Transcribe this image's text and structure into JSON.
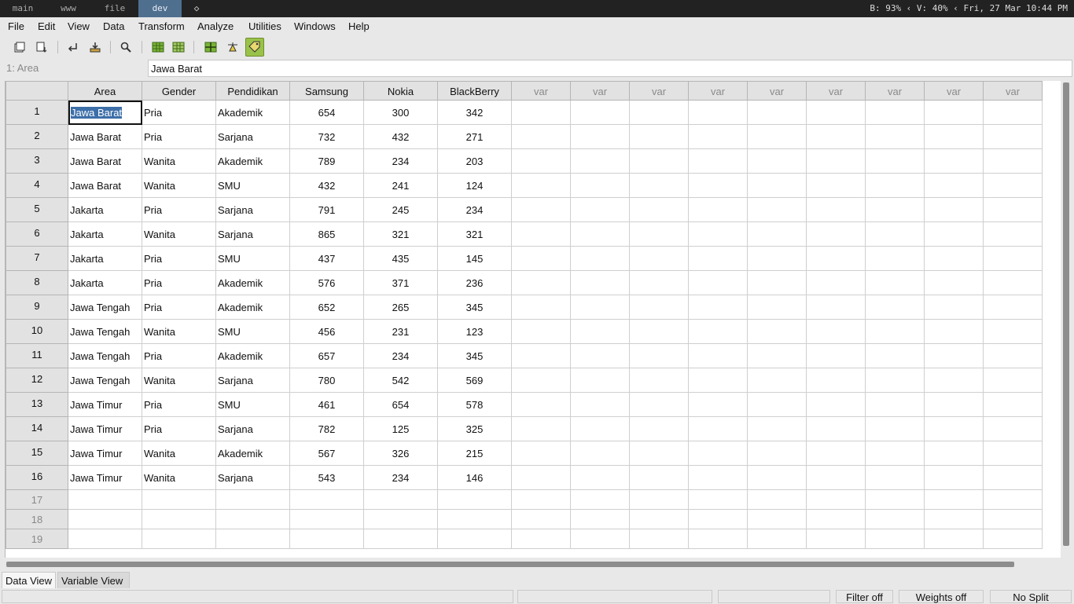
{
  "topbar": {
    "workspaces": [
      {
        "label": "main",
        "active": false
      },
      {
        "label": "www",
        "active": false
      },
      {
        "label": "file",
        "active": false
      },
      {
        "label": "dev",
        "active": true
      }
    ],
    "layout_symbol": "◇",
    "status": "B: 93% ‹ V: 40% ‹ Fri, 27 Mar 10:44 PM"
  },
  "menu": [
    "File",
    "Edit",
    "View",
    "Data",
    "Transform",
    "Analyze",
    "Utilities",
    "Windows",
    "Help"
  ],
  "toolbar": {
    "icons": [
      "open-file-icon",
      "save-file-icon",
      "goto-case-icon",
      "import-icon",
      "find-icon",
      "insert-cases-icon",
      "insert-variable-icon",
      "split-file-icon",
      "weight-cases-icon",
      "value-labels-icon"
    ]
  },
  "cellref": {
    "name": "1: Area",
    "value": "Jawa Barat"
  },
  "columns": [
    "Area",
    "Gender",
    "Pendidikan",
    "Samsung",
    "Nokia",
    "BlackBerry",
    "var",
    "var",
    "var",
    "var",
    "var",
    "var",
    "var",
    "var",
    "var"
  ],
  "rows": [
    {
      "n": "1",
      "cells": [
        "Jawa Barat",
        "Pria",
        "Akademik",
        "654",
        "300",
        "342"
      ]
    },
    {
      "n": "2",
      "cells": [
        "Jawa Barat",
        "Pria",
        "Sarjana",
        "732",
        "432",
        "271"
      ]
    },
    {
      "n": "3",
      "cells": [
        "Jawa Barat",
        "Wanita",
        "Akademik",
        "789",
        "234",
        "203"
      ]
    },
    {
      "n": "4",
      "cells": [
        "Jawa Barat",
        "Wanita",
        "SMU",
        "432",
        "241",
        "124"
      ]
    },
    {
      "n": "5",
      "cells": [
        "Jakarta",
        "Pria",
        "Sarjana",
        "791",
        "245",
        "234"
      ]
    },
    {
      "n": "6",
      "cells": [
        "Jakarta",
        "Wanita",
        "Sarjana",
        "865",
        "321",
        "321"
      ]
    },
    {
      "n": "7",
      "cells": [
        "Jakarta",
        "Pria",
        "SMU",
        "437",
        "435",
        "145"
      ]
    },
    {
      "n": "8",
      "cells": [
        "Jakarta",
        "Pria",
        "Akademik",
        "576",
        "371",
        "236"
      ]
    },
    {
      "n": "9",
      "cells": [
        "Jawa Tengah",
        "Pria",
        "Akademik",
        "652",
        "265",
        "345"
      ]
    },
    {
      "n": "10",
      "cells": [
        "Jawa Tengah",
        "Wanita",
        "SMU",
        "456",
        "231",
        "123"
      ]
    },
    {
      "n": "11",
      "cells": [
        "Jawa Tengah",
        "Pria",
        "Akademik",
        "657",
        "234",
        "345"
      ]
    },
    {
      "n": "12",
      "cells": [
        "Jawa Tengah",
        "Wanita",
        "Sarjana",
        "780",
        "542",
        "569"
      ]
    },
    {
      "n": "13",
      "cells": [
        "Jawa Timur",
        "Pria",
        "SMU",
        "461",
        "654",
        "578"
      ]
    },
    {
      "n": "14",
      "cells": [
        "Jawa Timur",
        "Pria",
        "Sarjana",
        "782",
        "125",
        "325"
      ]
    },
    {
      "n": "15",
      "cells": [
        "Jawa Timur",
        "Wanita",
        "Akademik",
        "567",
        "326",
        "215"
      ]
    },
    {
      "n": "16",
      "cells": [
        "Jawa Timur",
        "Wanita",
        "Sarjana",
        "543",
        "234",
        "146"
      ]
    }
  ],
  "empty_rows": [
    "17",
    "18",
    "19"
  ],
  "tabs": [
    {
      "label": "Data View",
      "active": true
    },
    {
      "label": "Variable View",
      "active": false
    }
  ],
  "statusbar": {
    "filter": "Filter off",
    "weights": "Weights off",
    "split": "No Split"
  },
  "colors": {
    "selection": "#3d6fa8",
    "active_workspace": "#4f6f8f",
    "value_labels_on": "#9ac24a"
  }
}
